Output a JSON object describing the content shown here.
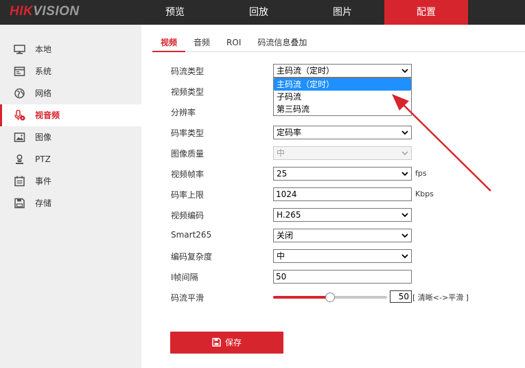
{
  "brand": {
    "logo_red": "HIK",
    "logo_gray": "VISION"
  },
  "nav": {
    "items": [
      {
        "label": "预览"
      },
      {
        "label": "回放"
      },
      {
        "label": "图片"
      },
      {
        "label": "配置"
      }
    ],
    "active": "配置"
  },
  "sidebar": {
    "items": [
      {
        "label": "本地",
        "icon": "monitor-icon"
      },
      {
        "label": "系统",
        "icon": "system-window-icon"
      },
      {
        "label": "网络",
        "icon": "globe-icon"
      },
      {
        "label": "视音频",
        "icon": "microphone-icon"
      },
      {
        "label": "图像",
        "icon": "image-icon"
      },
      {
        "label": "PTZ",
        "icon": "ptz-person-icon"
      },
      {
        "label": "事件",
        "icon": "calendar-icon"
      },
      {
        "label": "存储",
        "icon": "floppy-icon"
      }
    ],
    "active": "视音频"
  },
  "tabs": {
    "items": [
      {
        "label": "视频"
      },
      {
        "label": "音频"
      },
      {
        "label": "ROI"
      },
      {
        "label": "码流信息叠加"
      }
    ],
    "active": "视频"
  },
  "form": {
    "stream_type": {
      "label": "码流类型",
      "value": "主码流（定时）"
    },
    "video_type": {
      "label": "视频类型"
    },
    "resolution": {
      "label": "分辨率"
    },
    "bitrate_type": {
      "label": "码率类型",
      "value": "定码率"
    },
    "image_quality": {
      "label": "图像质量",
      "value": "中"
    },
    "frame_rate": {
      "label": "视频帧率",
      "value": "25",
      "unit": "fps"
    },
    "bitrate_limit": {
      "label": "码率上限",
      "value": "1024",
      "unit": "Kbps"
    },
    "video_encoding": {
      "label": "视频编码",
      "value": "H.265"
    },
    "smart265": {
      "label": "Smart265",
      "value": "关闭"
    },
    "complexity": {
      "label": "编码复杂度",
      "value": "中"
    },
    "i_frame": {
      "label": "I帧间隔",
      "value": "50"
    },
    "smoothing": {
      "label": "码流平滑",
      "value": 50,
      "value_text": "50",
      "hint": "[ 清晰<->平滑 ]",
      "min": 0,
      "max": 100
    }
  },
  "dropdown": {
    "options": [
      {
        "label": "主码流（定时）"
      },
      {
        "label": "子码流"
      },
      {
        "label": "第三码流"
      }
    ],
    "selected": "主码流（定时）"
  },
  "save": {
    "label": "保存"
  },
  "colors": {
    "accent": "#d7252d",
    "header_bg": "#2b2b2b",
    "sidebar_bg": "#efefef",
    "highlight": "#1e90ff"
  }
}
